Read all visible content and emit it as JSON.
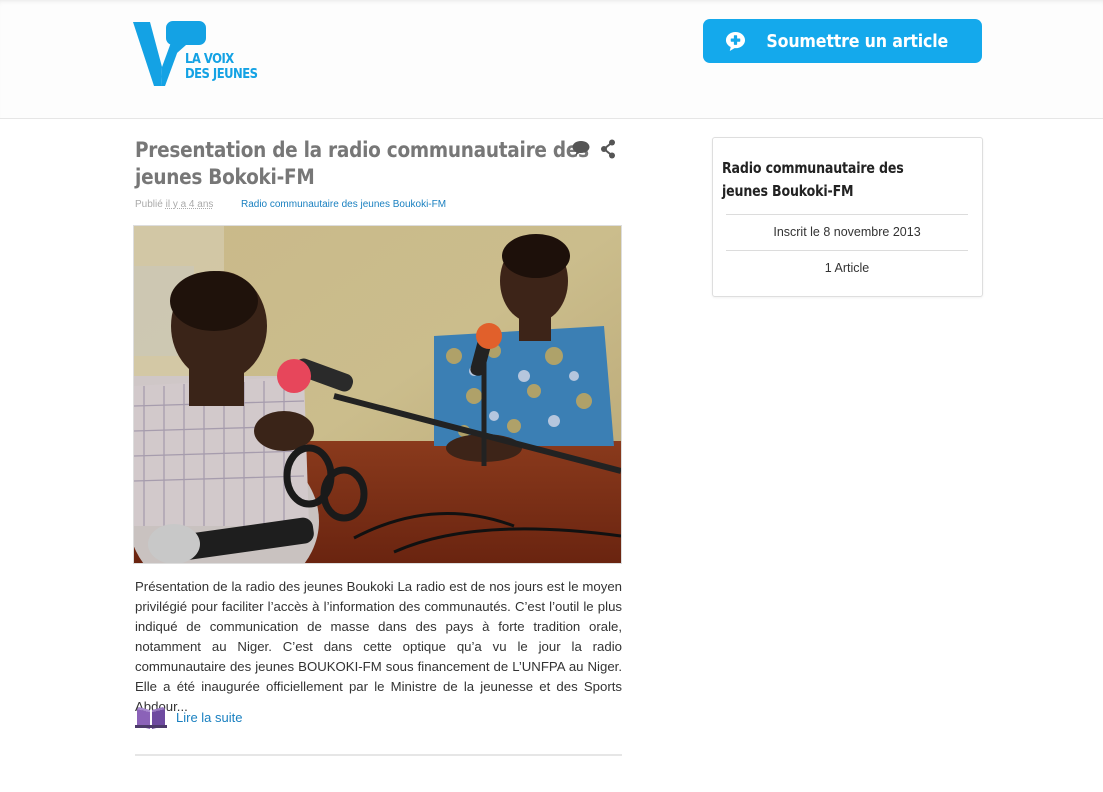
{
  "header": {
    "logo_line1": "LA VOIX",
    "logo_line2": "DES JEUNES",
    "submit_label": "Soumettre un article",
    "accent_color": "#14a9ec"
  },
  "article": {
    "title_line1": "Presentation de la radio communautaire des",
    "title_line2": "jeunes Bokoki-FM",
    "published_prefix": "Publié",
    "published_when": "il y a 4 ans",
    "author": "Radio communautaire des jeunes Boukoki-FM",
    "comment_icon": "comment-icon",
    "share_icon": "share-icon",
    "excerpt": "Présentation de la radio des jeunes Boukoki La radio est de nos jours est le moyen privilégié pour faciliter l’accès à l’information des communautés. C’est l’outil le plus indiqué de communication de masse dans des pays à forte tradition orale, notamment au Niger. C’est dans cette optique qu’a vu le jour la radio communautaire des jeunes BOUKOKI-FM sous financement de L’UNFPA au Niger. Elle a été inaugurée officiellement par le Ministre de la jeunesse et des Sports Abdour...",
    "read_more": "Lire la suite",
    "link_color": "#1a80c0"
  },
  "sidebar": {
    "title": "Radio communautaire des jeunes Boukoki-FM",
    "registered": "Inscrit le 8 novembre 2013",
    "articles_count": "1 Article"
  }
}
